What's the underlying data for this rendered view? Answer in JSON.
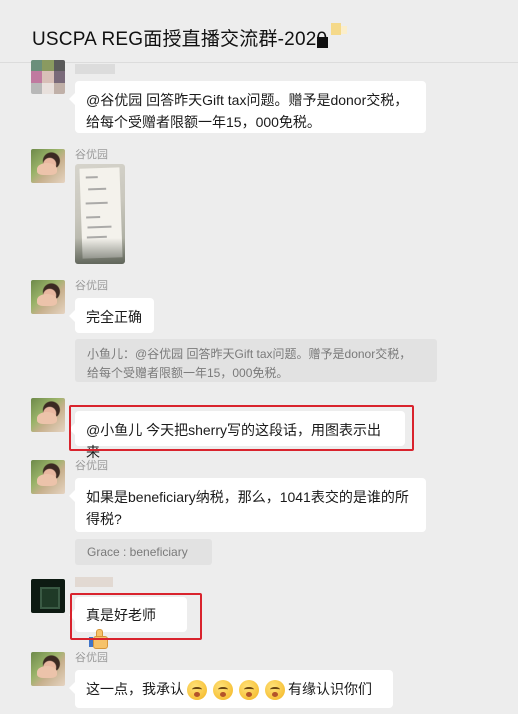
{
  "header": {
    "title": "USCPA REG面授直播交流群-2020"
  },
  "messages": [
    {
      "id": "m1",
      "text_lines": [
        "@谷优园 回答昨天Gift tax问题。赠予是donor交税，",
        "给每个受赠者限额一年15，000免税。"
      ]
    },
    {
      "id": "m2",
      "sender": "谷优园",
      "kind": "image"
    },
    {
      "id": "m3",
      "sender": "谷优园",
      "text": "完全正确",
      "quote_lines": [
        "小鱼儿：@谷优园 回答昨天Gift tax问题。赠予是donor交税，",
        "给每个受赠者限额一年15，000免税。"
      ]
    },
    {
      "id": "m4",
      "text": "@小鱼儿 今天把sherry写的这段话，用图表示出来"
    },
    {
      "id": "m5",
      "sender": "谷优园",
      "text_lines": [
        "如果是beneficiary纳税，那么，1041表交的是谁的所",
        "得税?"
      ],
      "quote": "Grace : beneficiary"
    },
    {
      "id": "m6",
      "text": "真是好老师",
      "icon": "thumbs-up-icon"
    },
    {
      "id": "m7",
      "sender": "谷优园",
      "text_before": "这一点，我承认",
      "text_after": "有缘认识你们",
      "icons": [
        "kissing-face-icon",
        "kissing-face-icon",
        "kissing-face-icon",
        "kissing-face-icon"
      ]
    }
  ],
  "colors": {
    "background": "#ededed",
    "bubble": "#ffffff",
    "highlight_border": "#d9232d",
    "quote_bg": "#e2e2e2",
    "nickname": "#9a9a9a"
  }
}
